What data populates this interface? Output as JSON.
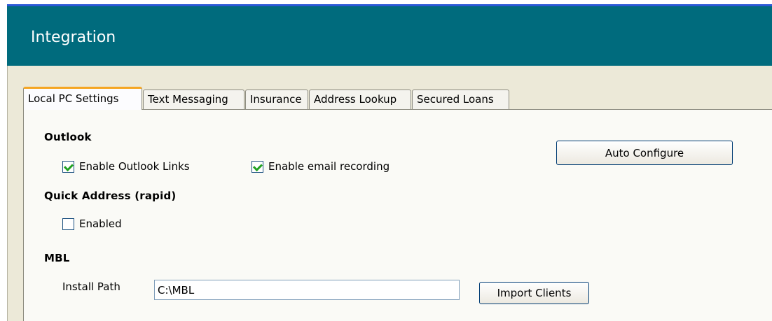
{
  "header": {
    "title": "Integration"
  },
  "tabs": [
    {
      "label": "Local PC Settings",
      "active": true
    },
    {
      "label": "Text Messaging",
      "active": false
    },
    {
      "label": "Insurance",
      "active": false
    },
    {
      "label": "Address Lookup",
      "active": false
    },
    {
      "label": "Secured Loans",
      "active": false
    }
  ],
  "outlook": {
    "heading": "Outlook",
    "enable_links_label": "Enable Outlook Links",
    "enable_links_checked": true,
    "email_recording_label": "Enable email recording",
    "email_recording_checked": true,
    "auto_configure_label": "Auto Configure"
  },
  "quick_address": {
    "heading": "Quick Address (rapid)",
    "enabled_label": "Enabled",
    "enabled_checked": false
  },
  "mbl": {
    "heading": "MBL",
    "install_path_label": "Install Path",
    "install_path_value": "C:\\MBL",
    "import_clients_label": "Import Clients"
  },
  "colors": {
    "header_bg": "#006b7d",
    "tab_active_accent": "#f5a623",
    "check_mark": "#21a121"
  }
}
